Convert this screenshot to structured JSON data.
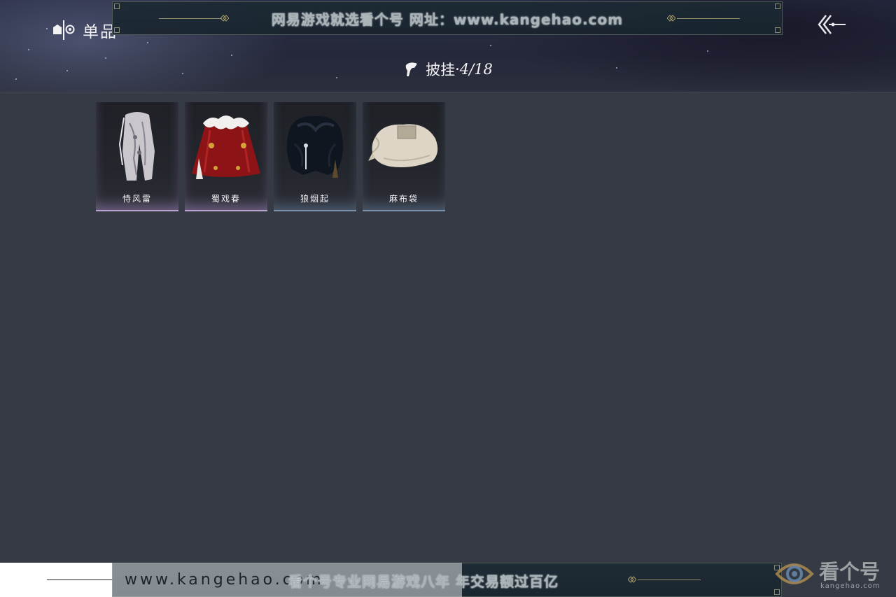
{
  "header": {
    "section_title": "单品",
    "category": "披挂",
    "count": "·4/18"
  },
  "watermark": {
    "top_text": "网易游戏就选看个号   网址：www.kangehao.com",
    "bottom_url": "www.kangehao.com",
    "bottom_slogan": "看个号专业网易游戏八年   年交易额过百亿",
    "brand_name": "看个号",
    "brand_url": "kangehao.com"
  },
  "items": [
    {
      "name": "恃风雷",
      "rarity": "rare",
      "art": "grey-robe-icon"
    },
    {
      "name": "蜀戏春",
      "rarity": "rare",
      "art": "red-fur-cape-icon"
    },
    {
      "name": "狼烟起",
      "rarity": "common",
      "art": "black-fur-cape-icon"
    },
    {
      "name": "麻布袋",
      "rarity": "common",
      "art": "cloth-sack-icon"
    }
  ],
  "colors": {
    "background": "#363a44",
    "rare_glow": "#b8a4cc",
    "common_glow": "#7a90a8"
  }
}
